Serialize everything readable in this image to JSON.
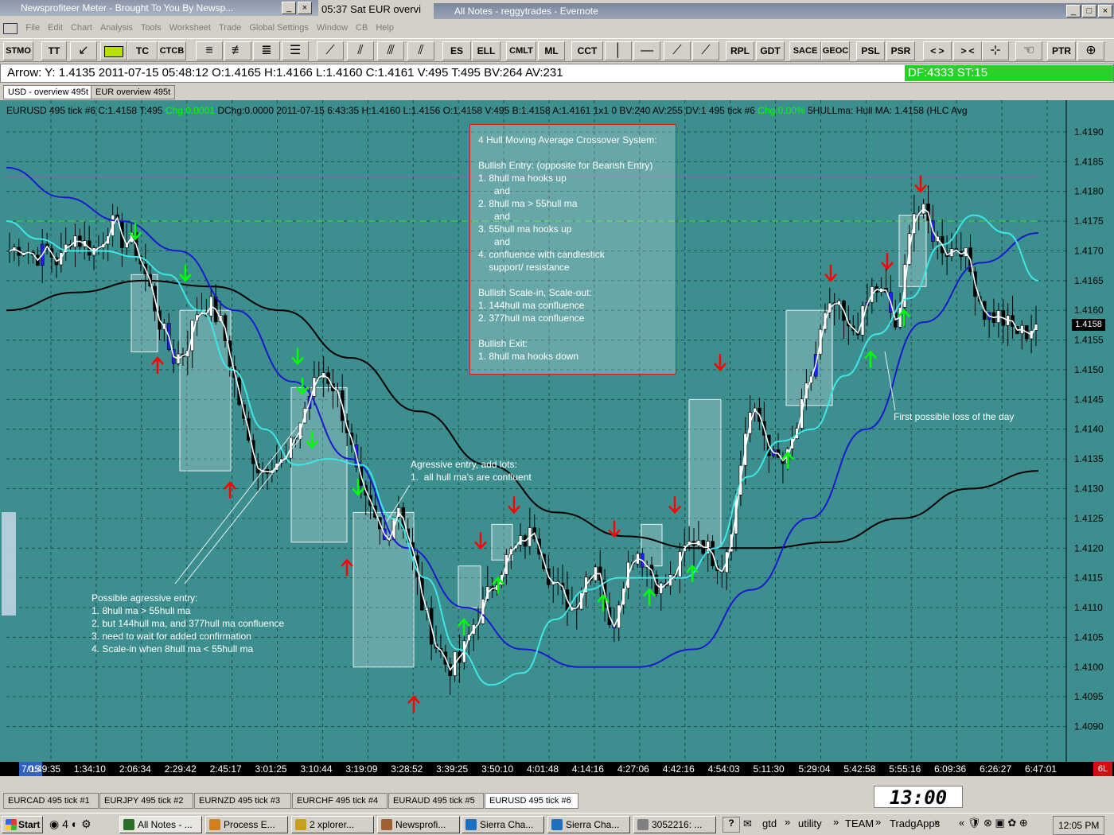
{
  "windows": {
    "back_title": "Newsprofiteer Meter - Brought To You By Newsp...",
    "mid_title": "05:37  Sat   EUR overvi",
    "evernote_title": "All Notes - reggytrades - Evernote"
  },
  "menu": [
    "File",
    "Edit",
    "Chart",
    "Analysis",
    "Tools",
    "Worksheet",
    "Trade",
    "Global Settings",
    "Window",
    "CB",
    "Help"
  ],
  "toolbar": [
    "TT",
    "TC",
    "CTCB",
    "ES",
    "ELL",
    "CMLT",
    "ML",
    "CCT",
    "RPL",
    "GDT",
    "SACE",
    "GEOC",
    "PSL",
    "PSR",
    "< >",
    "> <",
    "PTR"
  ],
  "toolbar_stmo": "STMO",
  "status": {
    "arrow_text": "Arrow: Y: 1.4135  2011-07-15  05:48:12  O:1.4165  H:1.4166  L:1.4160  C:1.4161  V:495  T:495  BV:264  AV:231",
    "df_text": "DF:4333  ST:15"
  },
  "tabs_top": [
    "USD - overview 495t",
    "EUR overview 495t"
  ],
  "chart": {
    "header_line_1": "EURUSD  495 tick  #6 C:1.4158 T:495",
    "header_chg": "Chg:0.0001",
    "header_line_2": "DChg:0.0000 2011-07-15 6:43:35 H:1.4160 L:1.4156 O:1.4158 V:495 B:1.4158 A:1.4161 1x1 0 BV:240 AV:255 DV:1 495 tick #6",
    "header_chg2": "Chg:0.00%",
    "header_tail": "5HULLma:    Hull MA: 1.4158   (HLC Avg",
    "price_labels": [
      "1.4190",
      "1.4185",
      "1.4180",
      "1.4175",
      "1.4170",
      "1.4165",
      "1.4160",
      "1.4155",
      "1.4150",
      "1.4145",
      "1.4140",
      "1.4135",
      "1.4130",
      "1.4125",
      "1.4120",
      "1.4115",
      "1.4110",
      "1.4105",
      "1.4100",
      "1.4095",
      "1.4090"
    ],
    "last_price": "1.4158",
    "system_box": [
      "4 Hull Moving Average Crossover System:",
      "",
      "Bullish Entry: (opposite for Bearish Entry)",
      "1. 8hull ma hooks up",
      "      and",
      "2. 8hull ma > 55hull ma",
      "      and",
      "3. 55hull ma hooks up",
      "      and",
      "4. confluence with candlestick",
      "    support/ resistance",
      "",
      "Bullish Scale-in, Scale-out:",
      "1. 144hull ma confluence",
      "2. 377hull ma confluence",
      "",
      "Bullish Exit:",
      "1. 8hull ma hooks down"
    ],
    "note_aggressive": [
      "Agressive entry, add lots:",
      "1.  all hull ma's are confluent"
    ],
    "note_possible": [
      "Possible agressive entry:",
      "1. 8hull ma > 55hull ma",
      "2. but 144hull ma, and 377hull ma confluence",
      "3. need to wait for added confirmation",
      "4. Scale-in when 8hull ma < 55hull ma"
    ],
    "note_loss": "First possible loss of the day"
  },
  "chart_data": {
    "type": "candlestick",
    "symbol": "EURUSD 495 tick",
    "ylim": [
      1.4087,
      1.4194
    ],
    "y_ticks": [
      1.419,
      1.4185,
      1.418,
      1.4175,
      1.417,
      1.4165,
      1.416,
      1.4155,
      1.415,
      1.4145,
      1.414,
      1.4135,
      1.413,
      1.4125,
      1.412,
      1.4115,
      1.411,
      1.4105,
      1.41,
      1.4095,
      1.409
    ],
    "x_labels": [
      "0:49:35",
      "1:34:10",
      "2:06:34",
      "2:29:42",
      "2:45:17",
      "3:01:25",
      "3:10:44",
      "3:19:09",
      "3:28:52",
      "3:39:25",
      "3:50:10",
      "4:01:48",
      "4:14:16",
      "4:27:06",
      "4:42:16",
      "4:54:03",
      "5:11:30",
      "5:29:04",
      "5:42:58",
      "5:55:16",
      "6:09:36",
      "6:26:27",
      "6:47:01"
    ],
    "close_path": [
      1.417,
      1.4171,
      1.4169,
      1.417,
      1.4168,
      1.4173,
      1.4171,
      1.417,
      1.4175,
      1.4172,
      1.4171,
      1.4165,
      1.4158,
      1.4152,
      1.4153,
      1.416,
      1.4161,
      1.4157,
      1.4148,
      1.4138,
      1.4133,
      1.4135,
      1.4134,
      1.414,
      1.4146,
      1.415,
      1.4147,
      1.414,
      1.4129,
      1.4125,
      1.4121,
      1.4128,
      1.412,
      1.411,
      1.4104,
      1.41,
      1.4101,
      1.4107,
      1.4111,
      1.4116,
      1.4119,
      1.4121,
      1.4123,
      1.4116,
      1.4112,
      1.411,
      1.4115,
      1.4118,
      1.4105,
      1.4115,
      1.412,
      1.4117,
      1.4113,
      1.4115,
      1.412,
      1.4122,
      1.4119,
      1.4117,
      1.4128,
      1.4143,
      1.4141,
      1.4135,
      1.4134,
      1.4141,
      1.4149,
      1.4158,
      1.4161,
      1.4156,
      1.4158,
      1.4164,
      1.4162,
      1.4156,
      1.4177,
      1.4176,
      1.4172,
      1.417,
      1.4171,
      1.4165,
      1.4159,
      1.4159,
      1.4157,
      1.4156,
      1.4158
    ],
    "series": [
      {
        "name": "8hull ma",
        "color": "#ffffff"
      },
      {
        "name": "55hull ma",
        "color": "#3ee6e6",
        "values": [
          1.4175,
          1.4172,
          1.417,
          1.417,
          1.4169,
          1.4166,
          1.416,
          1.415,
          1.414,
          1.4134,
          1.4135,
          1.4134,
          1.4125,
          1.4115,
          1.4103,
          1.4097,
          1.4099,
          1.4108,
          1.4113,
          1.4115,
          1.4115,
          1.4115,
          1.412,
          1.4132,
          1.4138,
          1.414,
          1.4149,
          1.4156,
          1.4162,
          1.4171,
          1.4176,
          1.4173,
          1.4165
        ]
      },
      {
        "name": "144hull ma",
        "color": "#1a1acc",
        "values": [
          1.4184,
          1.4179,
          1.4175,
          1.417,
          1.416,
          1.4148,
          1.4135,
          1.412,
          1.411,
          1.4103,
          1.41,
          1.41,
          1.4103,
          1.4113,
          1.4125,
          1.414,
          1.4158,
          1.4168,
          1.4173
        ]
      },
      {
        "name": "377hull ma",
        "color": "#000000",
        "values": [
          1.416,
          1.4163,
          1.4165,
          1.4164,
          1.416,
          1.4152,
          1.4143,
          1.4134,
          1.4126,
          1.4122,
          1.412,
          1.412,
          1.4121,
          1.4125,
          1.413,
          1.4133
        ]
      }
    ]
  },
  "datebar": {
    "date": "7/15",
    "corner": "6L"
  },
  "bottom_tabs": [
    "EURCAD  495 tick  #1",
    "EURJPY  495 tick  #2",
    "EURNZD  495 tick  #3",
    "EURCHF  495 tick  #4",
    "EURAUD  495 tick  #5",
    "EURUSD  495 tick  #6"
  ],
  "clock": "13:00",
  "taskbar": {
    "start": "Start",
    "tasks": [
      "All Notes - ...",
      "Process E...",
      "2 xplorer...",
      "Newsprofi...",
      "Sierra Cha...",
      "Sierra Cha...",
      "3052216: ..."
    ],
    "tray_items": [
      "gtd",
      "utility",
      "TEAM",
      "TradgApps"
    ],
    "time": "12:05 PM"
  },
  "colors": {
    "chart_bg": "#3d8f8f",
    "bull_arrow": "#00ff00",
    "bear_arrow": "#ff0000"
  }
}
